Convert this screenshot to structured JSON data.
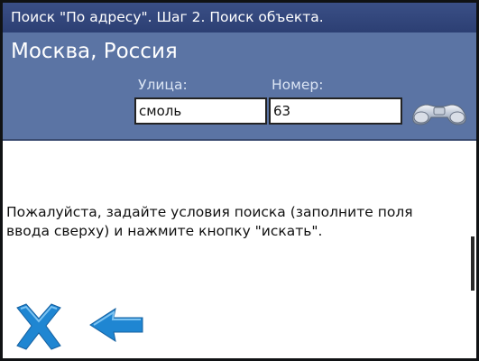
{
  "window": {
    "title": "Поиск \"По адресу\". Шаг 2. Поиск объекта."
  },
  "header": {
    "location": "Москва, Россия",
    "street_label": "Улица:",
    "street_value": "смоль",
    "number_label": "Номер:",
    "number_value": "63",
    "search_icon": "binoculars-icon"
  },
  "main": {
    "instruction": "Пожалуйста, задайте условия поиска (заполните поля ввода сверху) и нажмите кнопку \"искать\"."
  },
  "toolbar": {
    "close_icon": "close-x-icon",
    "back_icon": "back-arrow-icon"
  },
  "colors": {
    "title_bar": "#2c3f73",
    "header_panel": "#5b74a4",
    "icon_blue": "#1f86d2"
  }
}
